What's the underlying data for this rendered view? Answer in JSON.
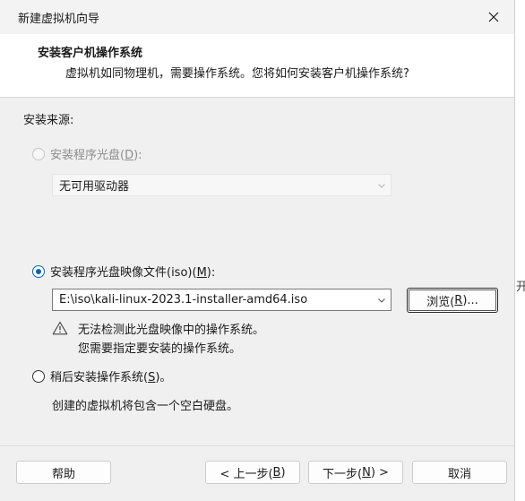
{
  "window": {
    "title": "新建虚拟机向导"
  },
  "header": {
    "title": "安装客户机操作系统",
    "description": "虚拟机如同物理机，需要操作系统。您将如何安装客户机操作系统?"
  },
  "source": {
    "group_label": "安装来源:",
    "disc_option": {
      "label_prefix": "安装程序光盘(",
      "accel": "D",
      "label_suffix": "):",
      "selected": false,
      "enabled": false
    },
    "disc_drive_select": {
      "value": "无可用驱动器"
    },
    "iso_option": {
      "label_prefix": "安装程序光盘映像文件(iso)(",
      "accel": "M",
      "label_suffix": "):",
      "selected": true
    },
    "iso_path_select": {
      "value": "E:\\iso\\kali-linux-2023.1-installer-amd64.iso"
    },
    "browse_button": {
      "label_prefix": "浏览(",
      "accel": "R",
      "label_suffix": ")..."
    },
    "warning": {
      "line1": "无法检测此光盘映像中的操作系统。",
      "line2": "您需要指定要安装的操作系统。"
    },
    "later_option": {
      "label_prefix": "稍后安装操作系统(",
      "accel": "S",
      "label_suffix": ")。",
      "selected": false
    },
    "later_description": "创建的虚拟机将包含一个空白硬盘。"
  },
  "footer": {
    "help_label": "帮助",
    "back_prefix": "< 上一步(",
    "back_accel": "B",
    "back_suffix": ")",
    "next_prefix": "下一步(",
    "next_accel": "N",
    "next_suffix": ") >",
    "cancel_label": "取消"
  },
  "background_fragment": "开",
  "colors": {
    "accent": "#0067c0",
    "dialog_bg": "#f0f0f0",
    "header_bg": "#ffffff"
  },
  "icons": {
    "close": "close-icon",
    "warning": "warning-icon",
    "dropdown": "chevron-down-icon"
  }
}
